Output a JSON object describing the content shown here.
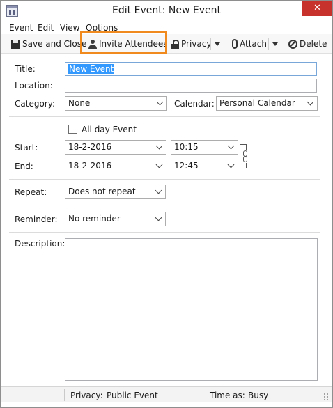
{
  "window": {
    "title": "Edit Event: New Event",
    "close_glyph": "✕"
  },
  "menu": {
    "event": "Event",
    "edit": "Edit",
    "view": "View",
    "options": "Options"
  },
  "toolbar": {
    "save_close": "Save and Close",
    "invite": "Invite Attendees",
    "privacy": "Privacy",
    "attach": "Attach",
    "delete": "Delete",
    "highlight_color": "#f08a1e"
  },
  "form": {
    "title_label": "Title:",
    "title_value": "New Event",
    "location_label": "Location:",
    "location_value": "",
    "category_label": "Category:",
    "category_value": "None",
    "calendar_label": "Calendar:",
    "calendar_value": "Personal Calendar",
    "all_day_label": "All day Event",
    "all_day_checked": false,
    "start_label": "Start:",
    "start_date": "18-2-2016",
    "start_time": "10:15",
    "end_label": "End:",
    "end_date": "18-2-2016",
    "end_time": "12:45",
    "repeat_label": "Repeat:",
    "repeat_value": "Does not repeat",
    "reminder_label": "Reminder:",
    "reminder_value": "No reminder",
    "description_label": "Description:",
    "description_value": ""
  },
  "status": {
    "privacy_label": "Privacy:",
    "privacy_value": "Public Event",
    "time_as_label": "Time as:",
    "time_as_value": "Busy"
  },
  "icons": [
    "calendar-app-icon",
    "save-icon",
    "person-icon",
    "lock-icon",
    "paperclip-icon",
    "delete-icon",
    "chain-link-icon",
    "resize-grip-icon"
  ]
}
